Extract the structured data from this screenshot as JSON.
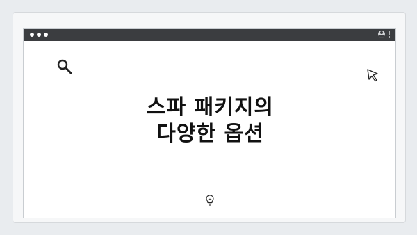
{
  "page_indicator": {
    "dots": 4
  },
  "window": {
    "traffic_lights": [
      "close",
      "minimize",
      "maximize"
    ],
    "icons": {
      "user": "user-circle-icon",
      "menu": "kebab-menu-icon",
      "search": "search-icon",
      "cursor": "cursor-arrow-icon",
      "bulb": "lightbulb-icon"
    }
  },
  "content": {
    "title_line1": "스파 패키지의",
    "title_line2": "다양한 옵션"
  },
  "colors": {
    "titlebar": "#3b3d40",
    "background": "#e9ecef",
    "text": "#111111"
  }
}
